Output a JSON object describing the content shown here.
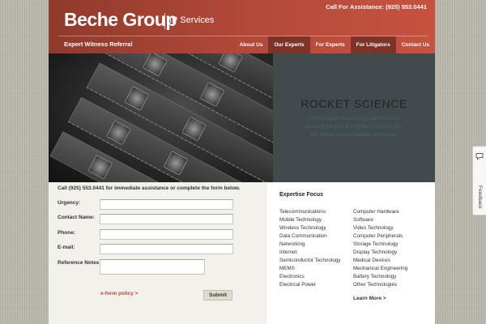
{
  "header": {
    "logo_main": "Beche Group",
    "logo_sub": "IP Services",
    "assistance": "Call For Assistance: (925) 553.0441",
    "referral": "Expert Witness Referral",
    "nav": [
      "About Us",
      "Our Experts",
      "For Experts",
      "For Litigators",
      "Contact Us"
    ]
  },
  "hero": {
    "title": "ROCKET SCIENCE",
    "lines": [
      "Your complex technology patent cases",
      "demand the best & brightest minds to win.",
      "We deliver superior expert witnesses."
    ]
  },
  "form": {
    "intro": "Call (925) 553.0441 for immediate assistance or complete the form below.",
    "labels": {
      "urgency": "Urgency:",
      "contact": "Contact Name:",
      "phone": "Phone:",
      "email": "E-mail:",
      "reference": "Reference Notes"
    },
    "eform_link": "e-form policy >",
    "submit_label": "Submit"
  },
  "expertise": {
    "title": "Expertise Focus",
    "col1": [
      "Telecommunications",
      "Mobile Technology",
      "Wireless Technology",
      "Data Communication",
      "Networking",
      "Internet",
      "Semiconductor Technology",
      "MEMS",
      "Electronics",
      "Electrical Power"
    ],
    "col2": [
      "Computer Hardware",
      "Software",
      "Video Technology",
      "Computer Peripherals",
      "Storage Technology",
      "Display Technology",
      "Medical Devices",
      "Mechanical Engineering",
      "Battery Technology",
      "Other Technologies"
    ],
    "learn_more": "Learn More >"
  },
  "feedback": {
    "label": "Feedback",
    "icon": "speech-bubble-icon"
  },
  "colors": {
    "header_red": "#b54a3a",
    "nav_dark": "#7d3327",
    "panel_slate": "#414b4e",
    "link_red": "#b94a36"
  }
}
